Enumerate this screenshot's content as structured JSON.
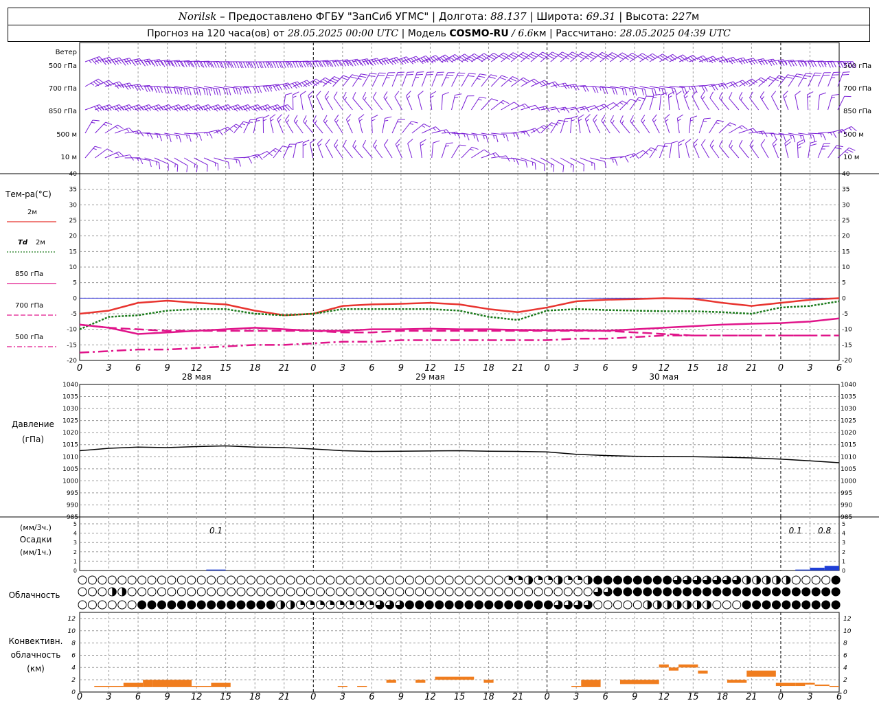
{
  "header": {
    "city": "Norilsk",
    "dash": " – ",
    "provider": "Предоставлено ФГБУ \"ЗапСиб УГМС\"",
    "sep": " | ",
    "lon_label": "Долгота: ",
    "lon_value": "88.137",
    "lat_label": "Широта: ",
    "lat_value": "69.31",
    "alt_label": "Высота: ",
    "alt_value": "227",
    "alt_unit": "м",
    "forecast_label": "Прогноз на 120 часа(ов) от ",
    "forecast_start": "28.05.2025 00:00 UTC",
    "model_label": "  | Модель ",
    "model_name": "COSMO-RU",
    "model_res_sep": " / ",
    "model_res": "6.6",
    "model_res_unit": "км",
    "calc_label": " | Рассчитано: ",
    "calc_time": "28.05.2025 04:39 UTC"
  },
  "wind_panel": {
    "title": "Ветер",
    "levels": [
      "500 гПа",
      "700 гПа",
      "850 гПа",
      "500 м",
      "10  м"
    ],
    "color": "#7a1fd6"
  },
  "temp_panel": {
    "title": "Тем-ра(°C)",
    "legend": [
      {
        "prefix": "",
        "label": "2м",
        "color": "#e8342f",
        "style": "solid"
      },
      {
        "prefix": "Td",
        "label": "2м",
        "color": "#1a7a1a",
        "style": "dotted"
      },
      {
        "prefix": "",
        "label": "850 гПа",
        "color": "#e0148a",
        "style": "solid"
      },
      {
        "prefix": "",
        "label": "700 гПа",
        "color": "#e0148a",
        "style": "dash"
      },
      {
        "prefix": "",
        "label": "500 гПа",
        "color": "#e0148a",
        "style": "dashdot"
      }
    ],
    "yticks": [
      "40",
      "35",
      "30",
      "25",
      "20",
      "15",
      "10",
      "5",
      "0",
      "-5",
      "-10",
      "-15",
      "-20"
    ]
  },
  "pressure_panel": {
    "title_line1": "Давление",
    "title_line2": "(гПа)",
    "yticks": [
      "1040",
      "1035",
      "1030",
      "1025",
      "1020",
      "1015",
      "1010",
      "1005",
      "1000",
      "995",
      "990",
      "985"
    ]
  },
  "precip_panel": {
    "title_line1": "(мм/3ч.)",
    "title_line2": "Осадки",
    "title_line3": "(мм/1ч.)",
    "yticks": [
      "5",
      "4",
      "3",
      "2",
      "1",
      "0"
    ],
    "annotations": [
      "0.1",
      "0.1",
      "0.8"
    ]
  },
  "cloud_panel": {
    "title": "Облачность"
  },
  "conv_panel": {
    "title_line1": "Конвективн.",
    "title_line2": "облачность",
    "title_line3": "(км)",
    "yticks": [
      "12",
      "10",
      "8",
      "6",
      "4",
      "2",
      "0"
    ]
  },
  "time_axis": {
    "hour_labels": [
      "0",
      "3",
      "6",
      "9",
      "12",
      "15",
      "18",
      "21",
      "0",
      "3",
      "6",
      "9",
      "12",
      "15",
      "18",
      "21",
      "0",
      "3",
      "6",
      "9",
      "12",
      "15",
      "18",
      "21",
      "0",
      "3",
      "6"
    ],
    "day_labels": [
      "28 мая",
      "29 мая",
      "30 мая"
    ]
  },
  "chart_data": [
    {
      "type": "line",
      "title": "Тем-ра(°C)",
      "x_hours": [
        0,
        3,
        6,
        9,
        12,
        15,
        18,
        21,
        24,
        27,
        30,
        33,
        36,
        39,
        42,
        45,
        48,
        51,
        54,
        57,
        60,
        63,
        66,
        69,
        72,
        75,
        78
      ],
      "ylim": [
        -20,
        40
      ],
      "series": [
        {
          "name": "2м",
          "values": [
            -5,
            -4,
            -1.5,
            -0.8,
            -1.5,
            -2,
            -4,
            -5.5,
            -5,
            -2.5,
            -2,
            -1.8,
            -1.5,
            -2,
            -3.5,
            -4.5,
            -3,
            -1,
            -0.5,
            -0.3,
            0,
            -0.2,
            -1.5,
            -2.5,
            -1.5,
            -0.5,
            0
          ]
        },
        {
          "name": "Td 2м",
          "values": [
            -10,
            -6,
            -5.5,
            -4,
            -3.5,
            -3.5,
            -5,
            -5.5,
            -5,
            -3.5,
            -3.5,
            -3.5,
            -3.5,
            -4,
            -6,
            -7,
            -4,
            -3.5,
            -3.8,
            -4,
            -4.2,
            -4.2,
            -4.5,
            -5,
            -3,
            -2.5,
            -1
          ]
        },
        {
          "name": "850 гПа",
          "values": [
            -8.5,
            -9.5,
            -11.5,
            -11,
            -10.5,
            -10,
            -9.5,
            -10,
            -10.5,
            -10.5,
            -10,
            -10,
            -9.8,
            -10,
            -10,
            -10.2,
            -10.3,
            -10.3,
            -10.5,
            -10,
            -9.5,
            -9,
            -8.5,
            -8.2,
            -8,
            -7.5,
            -6.5
          ]
        },
        {
          "name": "700 гПа",
          "values": [
            -8.5,
            -9.5,
            -10,
            -10.5,
            -10.5,
            -10.5,
            -10.5,
            -10.5,
            -10.5,
            -11,
            -11,
            -10.5,
            -10.5,
            -10.5,
            -10.5,
            -10.5,
            -10.5,
            -10.5,
            -10.5,
            -11,
            -11.5,
            -12,
            -12,
            -12,
            -12,
            -12,
            -12
          ]
        },
        {
          "name": "500 гПа",
          "values": [
            -17.5,
            -17,
            -16.5,
            -16.5,
            -16,
            -15.5,
            -15,
            -15,
            -14.5,
            -14,
            -14,
            -13.5,
            -13.5,
            -13.5,
            -13.5,
            -13.5,
            -13.5,
            -13,
            -13,
            -12.5,
            -12,
            -12,
            -12,
            -12,
            -12,
            -12,
            -12
          ]
        }
      ]
    },
    {
      "type": "line",
      "title": "Давление (гПа)",
      "x_hours": [
        0,
        3,
        6,
        9,
        12,
        15,
        18,
        21,
        24,
        27,
        30,
        33,
        36,
        39,
        42,
        45,
        48,
        51,
        54,
        57,
        60,
        63,
        66,
        69,
        72,
        75,
        78
      ],
      "ylim": [
        985,
        1040
      ],
      "series": [
        {
          "name": "Давление",
          "values": [
            1012.5,
            1013.5,
            1014,
            1013.8,
            1014.2,
            1014.5,
            1014,
            1013.8,
            1013.2,
            1012.5,
            1012.2,
            1012.3,
            1012.4,
            1012.5,
            1012.3,
            1012.2,
            1012,
            1011,
            1010.5,
            1010.2,
            1010.1,
            1010,
            1009.8,
            1009.5,
            1009,
            1008.3,
            1007.5
          ]
        }
      ]
    },
    {
      "type": "bar",
      "title": "Осадки",
      "ylim": [
        0,
        5
      ],
      "bars": [
        {
          "x_hours": [
            13,
            15
          ],
          "value": 0.1
        },
        {
          "x_hours": [
            73.5,
            75
          ],
          "value": 0.1
        },
        {
          "x_hours": [
            75,
            76.5
          ],
          "value": 0.3
        },
        {
          "x_hours": [
            76.5,
            78
          ],
          "value": 0.5
        }
      ]
    },
    {
      "type": "bar",
      "title": "Конвективн. облачность (км)",
      "ylim": [
        0,
        13
      ],
      "bars": [
        {
          "x_hours": [
            1.5,
            4.5
          ],
          "bottom": 0.8,
          "top": 1.0
        },
        {
          "x_hours": [
            4.5,
            6.5
          ],
          "bottom": 0.8,
          "top": 1.5
        },
        {
          "x_hours": [
            6.5,
            7.5
          ],
          "bottom": 0.8,
          "top": 2.0
        },
        {
          "x_hours": [
            7.5,
            11.5
          ],
          "bottom": 0.8,
          "top": 2.0
        },
        {
          "x_hours": [
            11.5,
            13.5
          ],
          "bottom": 0.8,
          "top": 1.0
        },
        {
          "x_hours": [
            13.5,
            15.5
          ],
          "bottom": 0.8,
          "top": 1.5
        },
        {
          "x_hours": [
            26.5,
            27.5
          ],
          "bottom": 0.8,
          "top": 1.0
        },
        {
          "x_hours": [
            28.5,
            29.5
          ],
          "bottom": 0.8,
          "top": 1.0
        },
        {
          "x_hours": [
            31.5,
            32.5
          ],
          "bottom": 1.5,
          "top": 2.0
        },
        {
          "x_hours": [
            34.5,
            35.5
          ],
          "bottom": 1.5,
          "top": 2.0
        },
        {
          "x_hours": [
            36.5,
            40.5
          ],
          "bottom": 2.0,
          "top": 2.5
        },
        {
          "x_hours": [
            41.5,
            42.5
          ],
          "bottom": 1.5,
          "top": 2.0
        },
        {
          "x_hours": [
            50.5,
            51.5
          ],
          "bottom": 0.8,
          "top": 1.0
        },
        {
          "x_hours": [
            51.5,
            53.5
          ],
          "bottom": 0.8,
          "top": 2.0
        },
        {
          "x_hours": [
            55.5,
            59.5
          ],
          "bottom": 1.3,
          "top": 2.0
        },
        {
          "x_hours": [
            59.5,
            60.5
          ],
          "bottom": 4.0,
          "top": 4.5
        },
        {
          "x_hours": [
            60.5,
            61.5
          ],
          "bottom": 3.5,
          "top": 4.0
        },
        {
          "x_hours": [
            61.5,
            63.5
          ],
          "bottom": 4.0,
          "top": 4.5
        },
        {
          "x_hours": [
            63.5,
            64.5
          ],
          "bottom": 3.0,
          "top": 3.5
        },
        {
          "x_hours": [
            66.5,
            68.5
          ],
          "bottom": 1.5,
          "top": 2.0
        },
        {
          "x_hours": [
            68.5,
            71.5
          ],
          "bottom": 2.5,
          "top": 3.5
        },
        {
          "x_hours": [
            71.5,
            73.5
          ],
          "bottom": 1.0,
          "top": 1.5
        },
        {
          "x_hours": [
            73.5,
            74.5
          ],
          "bottom": 1.0,
          "top": 1.5
        },
        {
          "x_hours": [
            74.5,
            75.5
          ],
          "bottom": 1.2,
          "top": 1.5
        },
        {
          "x_hours": [
            75.5,
            77
          ],
          "bottom": 1.0,
          "top": 1.2
        },
        {
          "x_hours": [
            77,
            78
          ],
          "bottom": 0.8,
          "top": 1.0
        }
      ]
    }
  ]
}
